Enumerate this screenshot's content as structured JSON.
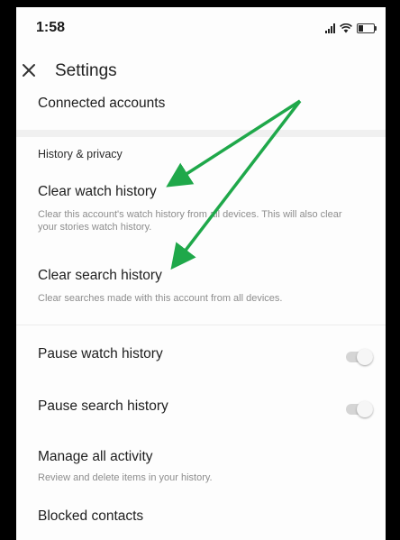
{
  "status_bar": {
    "time": "1:58",
    "signal_icon": "signal-icon",
    "wifi_icon": "wifi-icon",
    "battery_icon": "battery-icon",
    "battery_level": 0.3
  },
  "app_bar": {
    "close_icon": "close-icon",
    "title": "Settings"
  },
  "items": {
    "connected_accounts": {
      "label": "Connected accounts"
    },
    "section_history_privacy": "History & privacy",
    "clear_watch_history": {
      "label": "Clear watch history",
      "description": "Clear this account's watch history from all devices. This will also clear your stories watch history."
    },
    "clear_search_history": {
      "label": "Clear search history",
      "description": "Clear searches made with this account from all devices."
    },
    "pause_watch_history": {
      "label": "Pause watch history",
      "enabled": false
    },
    "pause_search_history": {
      "label": "Pause search history",
      "enabled": false
    },
    "manage_all_activity": {
      "label": "Manage all activity",
      "description": "Review and delete items in your history."
    },
    "blocked_contacts": {
      "label": "Blocked contacts"
    }
  },
  "colors": {
    "annotation_arrow": "#1fa84a",
    "background": "#fdfdfd",
    "toggle_off_track": "#d5d5d5"
  }
}
